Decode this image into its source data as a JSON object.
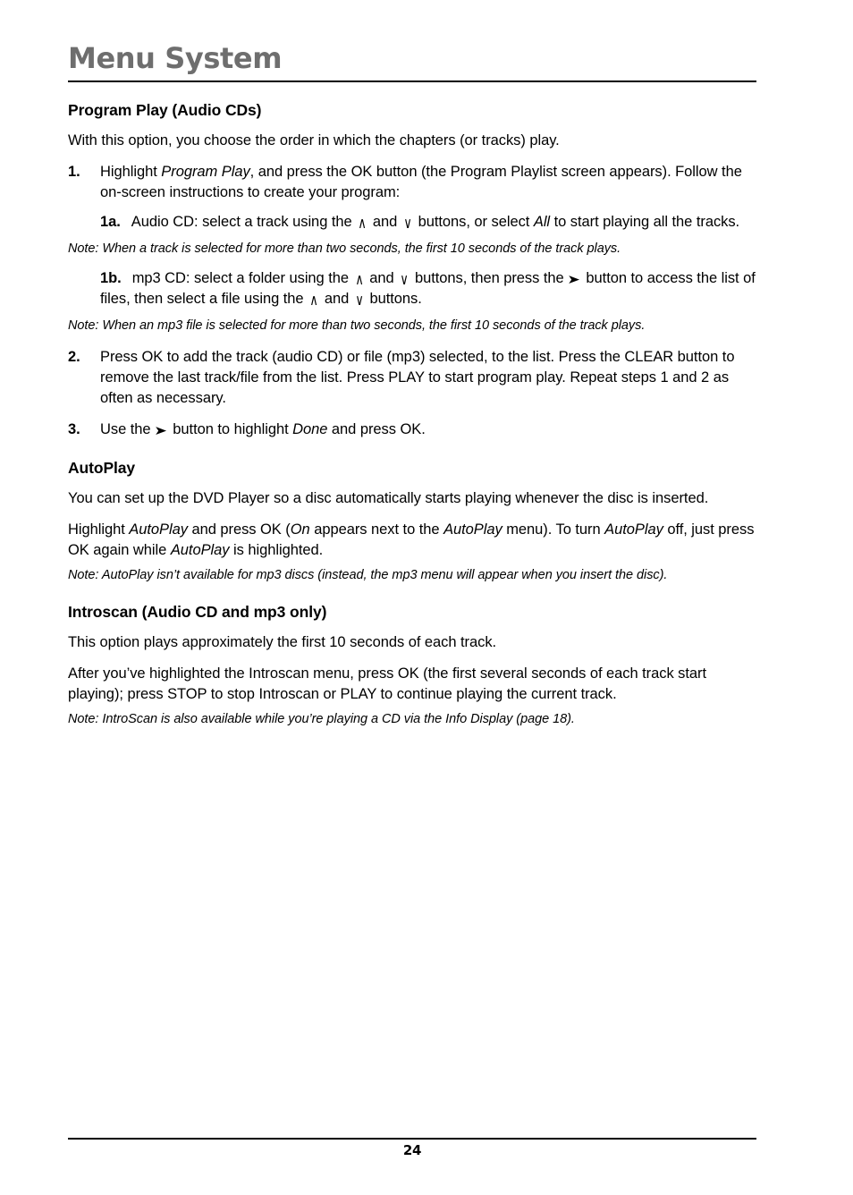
{
  "document": {
    "chapter_title": "Menu System",
    "page_number": "24",
    "title_color": "#6e6e6e"
  },
  "icons": {
    "arrow_up": "∧",
    "arrow_down": "∨",
    "arrow_right": "➤"
  },
  "sections": {
    "program_play": {
      "heading": "Program Play (Audio CDs)",
      "intro": "With this option, you choose the order in which the chapters (or tracks) play.",
      "step1": {
        "marker": "1.",
        "text_a": "Highlight ",
        "italic_a": "Program Play",
        "text_b": ", and press the OK button (the Program Playlist screen appears). Follow the on-screen instructions to create your program:"
      },
      "step1a": {
        "marker": "1a.",
        "text_a": "Audio CD: select a track using the ",
        "text_b": " and ",
        "text_c": " buttons, or select ",
        "italic_a": "All",
        "text_d": " to start playing all the tracks."
      },
      "note1": "Note: When a track is selected for more than two seconds, the first 10 seconds of the track plays.",
      "step1b": {
        "marker": "1b.",
        "text_a": "mp3 CD: select a folder using the ",
        "text_b": " and ",
        "text_c": " buttons, then press the ",
        "text_d": " button to access the list of files, then select a file using the ",
        "text_e": " and ",
        "text_f": " buttons."
      },
      "note2": "Note: When an mp3 file is selected for more than two seconds, the first 10 seconds of the track plays.",
      "step2": {
        "marker": "2.",
        "text": "Press OK to add the track (audio CD) or file (mp3) selected, to the list. Press the CLEAR button to remove the last track/file from the list. Press PLAY to start program play. Repeat steps 1 and 2 as often as necessary."
      },
      "step3": {
        "marker": "3.",
        "text_a": "Use the ",
        "text_b": " button to highlight ",
        "italic_a": "Done",
        "text_c": " and press OK."
      }
    },
    "autoplay": {
      "heading": "AutoPlay",
      "para1": "You can set up the DVD Player so a disc automatically starts playing whenever the disc is inserted.",
      "para2": {
        "text_a": "Highlight ",
        "italic_a": "AutoPlay",
        "text_b": " and press OK (",
        "italic_b": "On",
        "text_c": " appears next to the ",
        "italic_c": "AutoPlay",
        "text_d": " menu). To turn ",
        "italic_d": "AutoPlay",
        "text_e": " off, just press OK again while ",
        "italic_e": "AutoPlay",
        "text_f": " is highlighted."
      },
      "note": "Note: AutoPlay isn’t available for mp3 discs (instead, the mp3 menu will appear when you insert the disc)."
    },
    "introscan": {
      "heading": "Introscan (Audio CD and mp3 only)",
      "para1": "This option plays approximately the first 10 seconds of each track.",
      "para2": "After you’ve highlighted the Introscan menu, press OK (the first several seconds of each track start playing); press STOP to stop Introscan or PLAY to continue playing the current track.",
      "note": "Note: IntroScan is also available while you’re playing a CD via the Info Display (page 18)."
    }
  }
}
